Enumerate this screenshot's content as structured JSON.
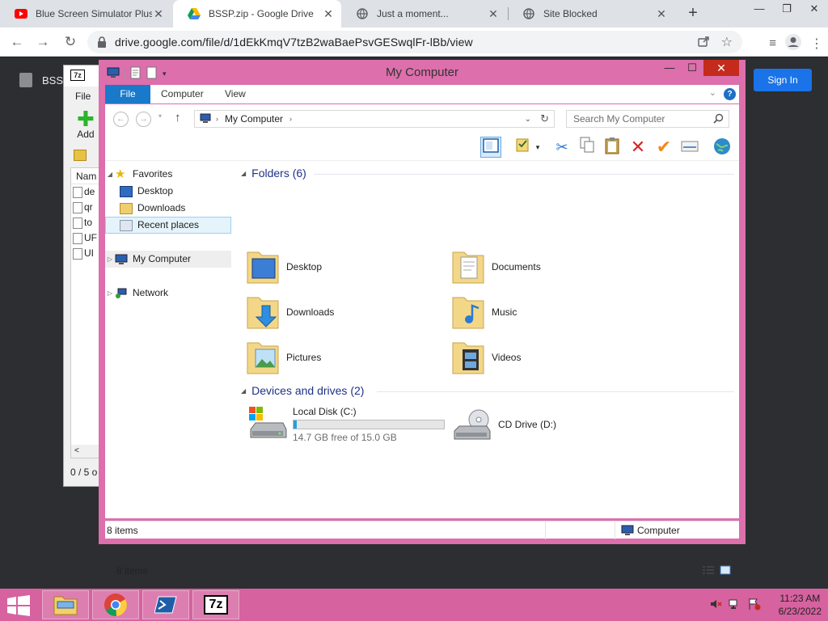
{
  "browser": {
    "tabs": [
      {
        "title": "Blue Screen Simulator Plus",
        "icon": "youtube-icon"
      },
      {
        "title": "BSSP.zip - Google Drive",
        "icon": "google-drive-icon"
      },
      {
        "title": "Just a moment...",
        "icon": "globe-icon"
      },
      {
        "title": "Site Blocked",
        "icon": "globe-icon"
      }
    ],
    "url": "drive.google.com/file/d/1dEkKmqV7tzB2waBaePsvGESwqlFr-lBb/view"
  },
  "drive_page": {
    "file_name": "BSSI",
    "sign_in_label": "Sign In"
  },
  "sevenzip": {
    "logo": "7z",
    "menu_file": "File",
    "add_label": "Add",
    "column_name": "Nam",
    "rows": [
      "de",
      "qr",
      "to",
      "UF",
      "UI"
    ],
    "status": "0 / 5 o"
  },
  "explorer": {
    "title": "My Computer",
    "ribbon_tabs": [
      "File",
      "Computer",
      "View"
    ],
    "address": "My Computer",
    "search_placeholder": "Search My Computer",
    "nav": {
      "favorites": "Favorites",
      "desktop": "Desktop",
      "downloads": "Downloads",
      "recent": "Recent places",
      "computer": "My Computer",
      "network": "Network"
    },
    "folders_header": "Folders (6)",
    "folders": [
      "Desktop",
      "Documents",
      "Downloads",
      "Music",
      "Pictures",
      "Videos"
    ],
    "devices_header": "Devices and drives (2)",
    "local_disk": {
      "name": "Local Disk (C:)",
      "free": "14.7 GB free of 15.0 GB",
      "used_fraction": 0.02
    },
    "cd_drive": "CD Drive (D:)",
    "items_count": "8 items",
    "status_items": "8 items",
    "status_location": "Computer"
  },
  "taskbar": {
    "time": "11:23 AM",
    "date": "6/23/2022",
    "sevenzip_label": "7z"
  }
}
